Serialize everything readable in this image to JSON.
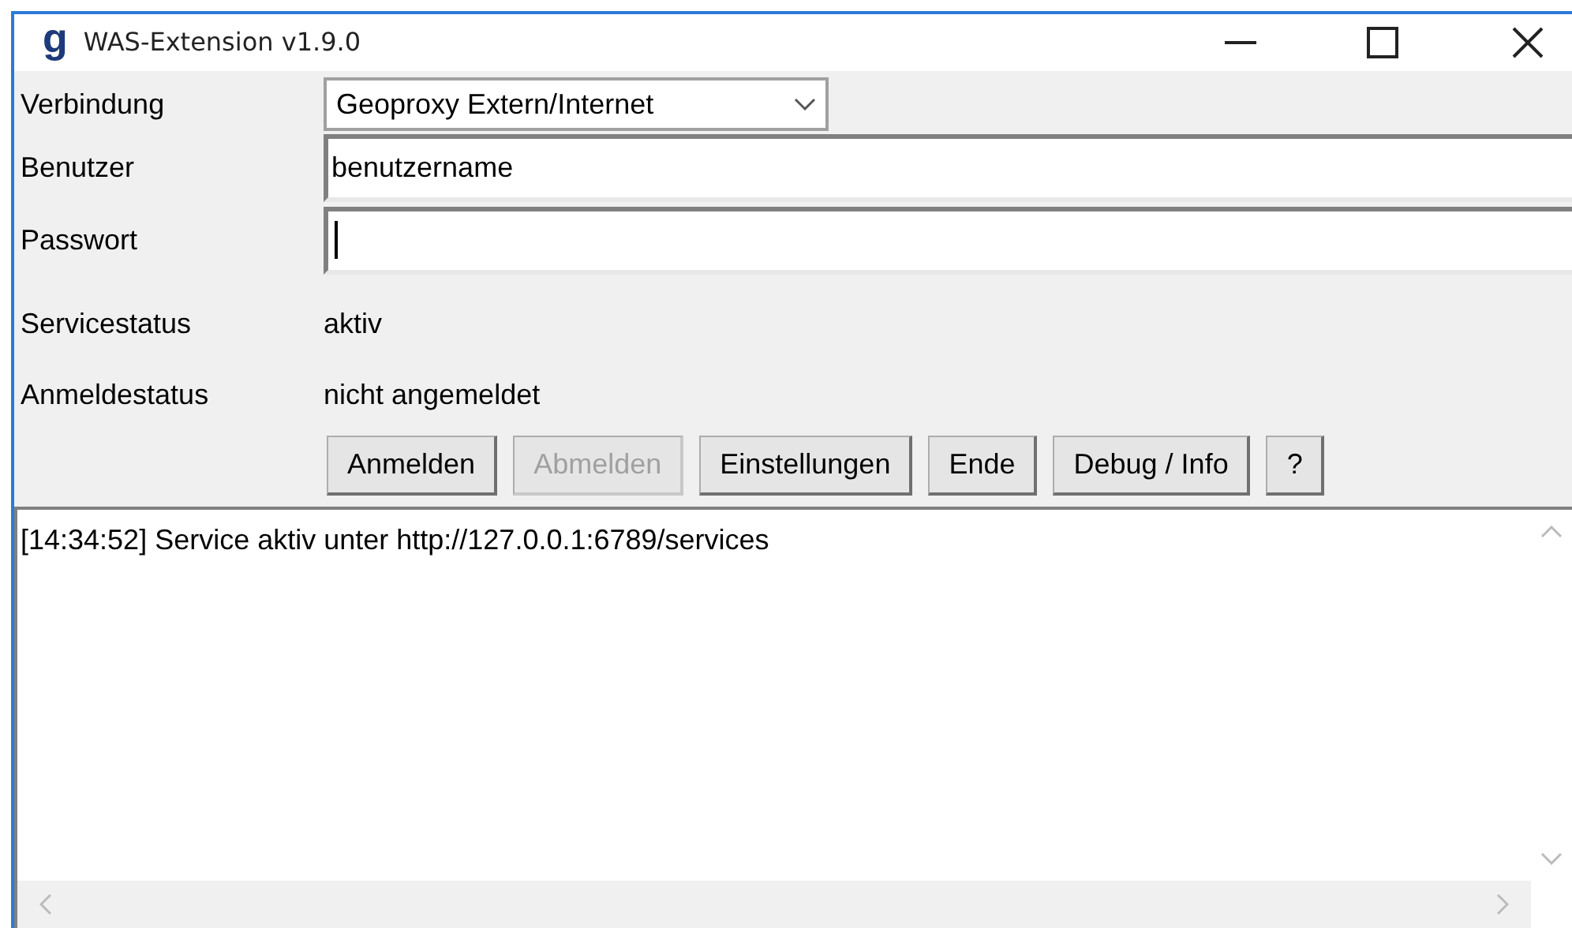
{
  "window": {
    "title": "WAS-Extension v1.9.0",
    "logo": "g"
  },
  "form": {
    "connection": {
      "label": "Verbindung",
      "value": "Geoproxy Extern/Internet"
    },
    "user": {
      "label": "Benutzer",
      "value": "benutzername"
    },
    "password": {
      "label": "Passwort",
      "focused": true
    },
    "statuses": [
      {
        "label": "Servicestatus",
        "value": "aktiv"
      },
      {
        "label": "Anmeldestatus",
        "value": "nicht angemeldet"
      }
    ]
  },
  "buttons": [
    {
      "label": "Anmelden",
      "disabled": false
    },
    {
      "label": "Abmelden",
      "disabled": true
    },
    {
      "label": "Einstellungen",
      "disabled": false
    },
    {
      "label": "Ende",
      "disabled": false
    },
    {
      "label": "Debug / Info",
      "disabled": false
    },
    {
      "label": "?",
      "disabled": false
    }
  ],
  "log": {
    "lines": [
      "[14:34:52] Service aktiv unter http://127.0.0.1:6789/services"
    ]
  }
}
